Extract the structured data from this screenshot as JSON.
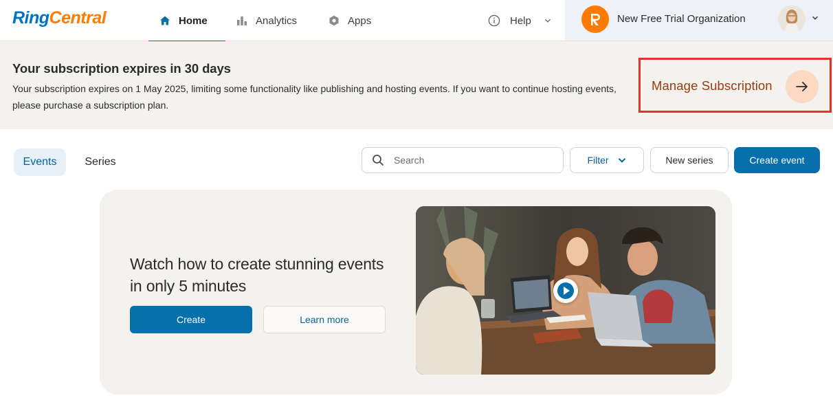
{
  "app": {
    "logo_part1": "Ring",
    "logo_part2": "Central"
  },
  "nav": {
    "tabs": [
      {
        "label": "Home",
        "icon": "home-icon",
        "active": true
      },
      {
        "label": "Analytics",
        "icon": "bar-chart-icon",
        "active": false
      },
      {
        "label": "Apps",
        "icon": "hexagon-icon",
        "active": false
      }
    ],
    "help_label": "Help",
    "organization_name": "New Free Trial Organization"
  },
  "banner": {
    "title": "Your subscription expires in 30 days",
    "text": "Your subscription expires on 1 May 2025, limiting some functionality like publishing and hosting events. If you want to continue hosting events, please purchase a subscription plan.",
    "cta_label": "Manage Subscription"
  },
  "toolbar": {
    "segments": [
      "Events",
      "Series"
    ],
    "active_segment": "Events",
    "search_placeholder": "Search",
    "filter_label": "Filter",
    "new_series_label": "New series",
    "create_event_label": "Create event"
  },
  "promo": {
    "title": "Watch how to create stunning events in only 5 minutes",
    "create_label": "Create",
    "learn_more_label": "Learn more"
  },
  "colors": {
    "primary": "#066fac",
    "brand_orange": "#ff7a00",
    "highlight_red": "#e8302b",
    "banner_bg": "#f4f2ef",
    "manage_text": "#9a3b12"
  }
}
